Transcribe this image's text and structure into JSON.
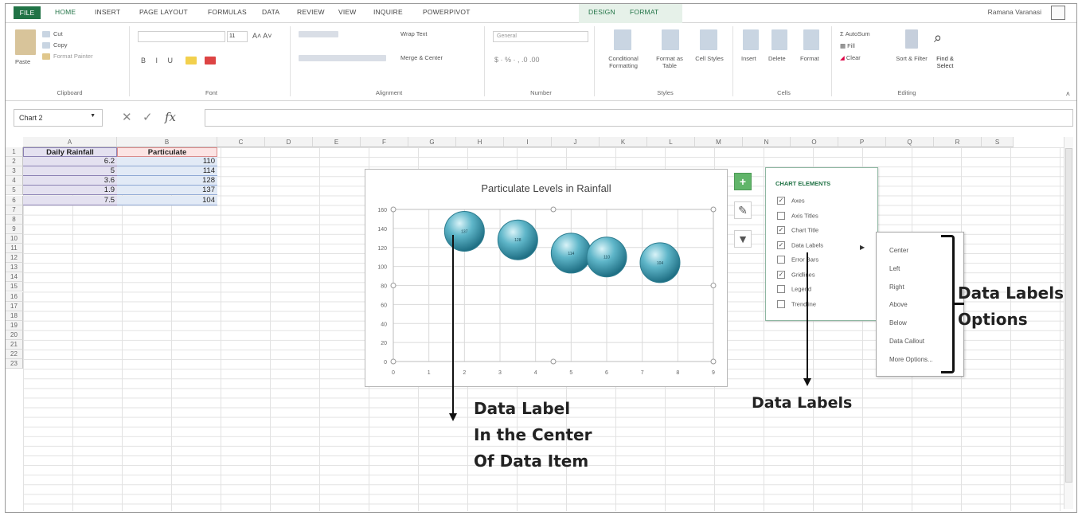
{
  "tabs": [
    "FILE",
    "HOME",
    "INSERT",
    "PAGE LAYOUT",
    "FORMULAS",
    "DATA",
    "REVIEW",
    "VIEW",
    "INQUIRE",
    "POWERPIVOT",
    "DESIGN",
    "FORMAT"
  ],
  "user": "Ramana Varanasi",
  "ribbon": {
    "clipboard": {
      "paste": "Paste",
      "cut": "Cut",
      "copy": "Copy",
      "format_painter": "Format Painter",
      "label": "Clipboard"
    },
    "font": {
      "size": "11",
      "label": "Font"
    },
    "alignment": {
      "wrap": "Wrap Text",
      "merge": "Merge & Center",
      "label": "Alignment"
    },
    "number": {
      "format": "General",
      "label": "Number"
    },
    "styles": {
      "cond": "Conditional Formatting",
      "table": "Format as Table",
      "cell": "Cell Styles",
      "label": "Styles"
    },
    "cells": {
      "insert": "Insert",
      "delete": "Delete",
      "format": "Format",
      "label": "Cells"
    },
    "editing": {
      "autosum": "AutoSum",
      "fill": "Fill",
      "clear": "Clear",
      "sort": "Sort & Filter",
      "find": "Find & Select",
      "label": "Editing"
    }
  },
  "formula_bar": {
    "name_box": "Chart 2",
    "fx": "fx",
    "value": ""
  },
  "columns": [
    "A",
    "B",
    "C",
    "D",
    "E",
    "F",
    "G",
    "H",
    "I",
    "J",
    "K",
    "L",
    "M",
    "N",
    "O",
    "P",
    "Q",
    "R",
    "S"
  ],
  "rows": [
    "1",
    "2",
    "3",
    "4",
    "5",
    "6",
    "7",
    "8",
    "9",
    "10",
    "11",
    "12",
    "13",
    "14",
    "15",
    "16",
    "17",
    "18",
    "19",
    "20",
    "21",
    "22",
    "23"
  ],
  "table": {
    "headers": [
      "Daily Rainfall",
      "Particulate"
    ],
    "rows": [
      [
        "6.2",
        "110"
      ],
      [
        "5",
        "114"
      ],
      [
        "3.6",
        "128"
      ],
      [
        "1.9",
        "137"
      ],
      [
        "7.5",
        "104"
      ]
    ]
  },
  "chart_data": {
    "type": "scatter",
    "title": "Particulate Levels in Rainfall",
    "x_ticks": [
      "0",
      "1",
      "2",
      "3",
      "4",
      "5",
      "6",
      "7",
      "8",
      "9"
    ],
    "y_ticks": [
      "0",
      "20",
      "40",
      "60",
      "80",
      "100",
      "120",
      "140",
      "160"
    ],
    "xlim": [
      0,
      9
    ],
    "ylim": [
      0,
      160
    ],
    "points": [
      {
        "x": 2,
        "y": 137,
        "label": "137"
      },
      {
        "x": 3.5,
        "y": 128,
        "label": "128"
      },
      {
        "x": 5,
        "y": 114,
        "label": "114"
      },
      {
        "x": 6,
        "y": 110,
        "label": "110"
      },
      {
        "x": 7.5,
        "y": 104,
        "label": "104"
      }
    ],
    "bubble_color": "#4fa3b8"
  },
  "chart_elements": {
    "title": "CHART ELEMENTS",
    "items": [
      {
        "label": "Axes",
        "checked": true
      },
      {
        "label": "Axis Titles",
        "checked": false
      },
      {
        "label": "Chart Title",
        "checked": true
      },
      {
        "label": "Data Labels",
        "checked": true
      },
      {
        "label": "Error Bars",
        "checked": false
      },
      {
        "label": "Gridlines",
        "checked": true
      },
      {
        "label": "Legend",
        "checked": false
      },
      {
        "label": "Trendline",
        "checked": false
      }
    ]
  },
  "data_label_options": [
    "Center",
    "Left",
    "Right",
    "Above",
    "Below",
    "Data Callout",
    "More Options..."
  ],
  "annotations": {
    "center_label": [
      "Data Label",
      "In the Center",
      "Of Data Item"
    ],
    "data_labels": "Data Labels",
    "options": [
      "Data Labels",
      "Options"
    ]
  },
  "colors": {
    "excel_green": "#217346"
  }
}
